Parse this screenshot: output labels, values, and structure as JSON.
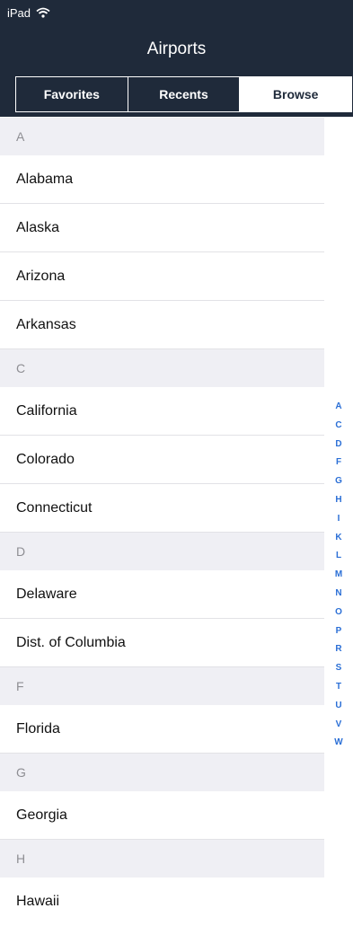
{
  "status_bar": {
    "device": "iPad",
    "wifi_icon": "wifi-icon"
  },
  "header": {
    "title": "Airports"
  },
  "tabs": [
    {
      "label": "Favorites",
      "active": false
    },
    {
      "label": "Recents",
      "active": false
    },
    {
      "label": "Browse",
      "active": true
    }
  ],
  "sections": [
    {
      "letter": "A",
      "items": [
        "Alabama",
        "Alaska",
        "Arizona",
        "Arkansas"
      ]
    },
    {
      "letter": "C",
      "items": [
        "California",
        "Colorado",
        "Connecticut"
      ]
    },
    {
      "letter": "D",
      "items": [
        "Delaware",
        "Dist. of Columbia"
      ]
    },
    {
      "letter": "F",
      "items": [
        "Florida"
      ]
    },
    {
      "letter": "G",
      "items": [
        "Georgia"
      ]
    },
    {
      "letter": "H",
      "items": [
        "Hawaii"
      ]
    }
  ],
  "index_letters": [
    "A",
    "C",
    "D",
    "F",
    "G",
    "H",
    "I",
    "K",
    "L",
    "M",
    "N",
    "O",
    "P",
    "R",
    "S",
    "T",
    "U",
    "V",
    "W"
  ],
  "colors": {
    "header_bg": "#1f2a3a",
    "section_bg": "#efeff4",
    "index_accent": "#2b6fd6"
  }
}
